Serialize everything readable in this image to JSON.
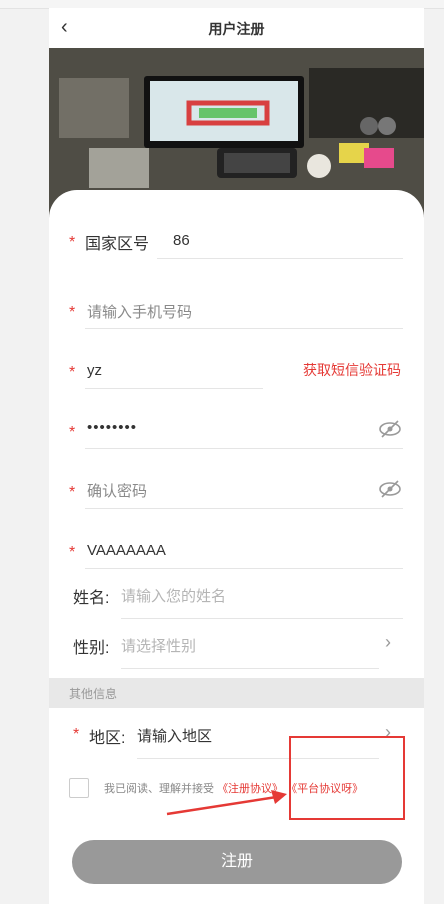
{
  "header": {
    "title": "用户注册",
    "back_glyph": "‹"
  },
  "form": {
    "country": {
      "label": "国家区号",
      "value": "86"
    },
    "phone": {
      "placeholder": "请输入手机号码"
    },
    "code": {
      "value": "yz",
      "sms_button": "获取短信验证码"
    },
    "password": {
      "value": "••••••••"
    },
    "confirm": {
      "placeholder": "确认密码"
    },
    "invite": {
      "value": "VAAAAAAA"
    },
    "name": {
      "label": "姓名:",
      "placeholder": "请输入您的姓名"
    },
    "gender": {
      "label": "性别:",
      "placeholder": "请选择性别"
    }
  },
  "section": {
    "title": "其他信息"
  },
  "region": {
    "label": "地区:",
    "placeholder": "请输入地区"
  },
  "agreement": {
    "text": "我已阅读、理解并接受",
    "link1": "《注册协议》",
    "link2": "《平台协议呀》"
  },
  "submit": {
    "label": "注册"
  },
  "colors": {
    "accent": "#e53935",
    "button": "#999999"
  }
}
